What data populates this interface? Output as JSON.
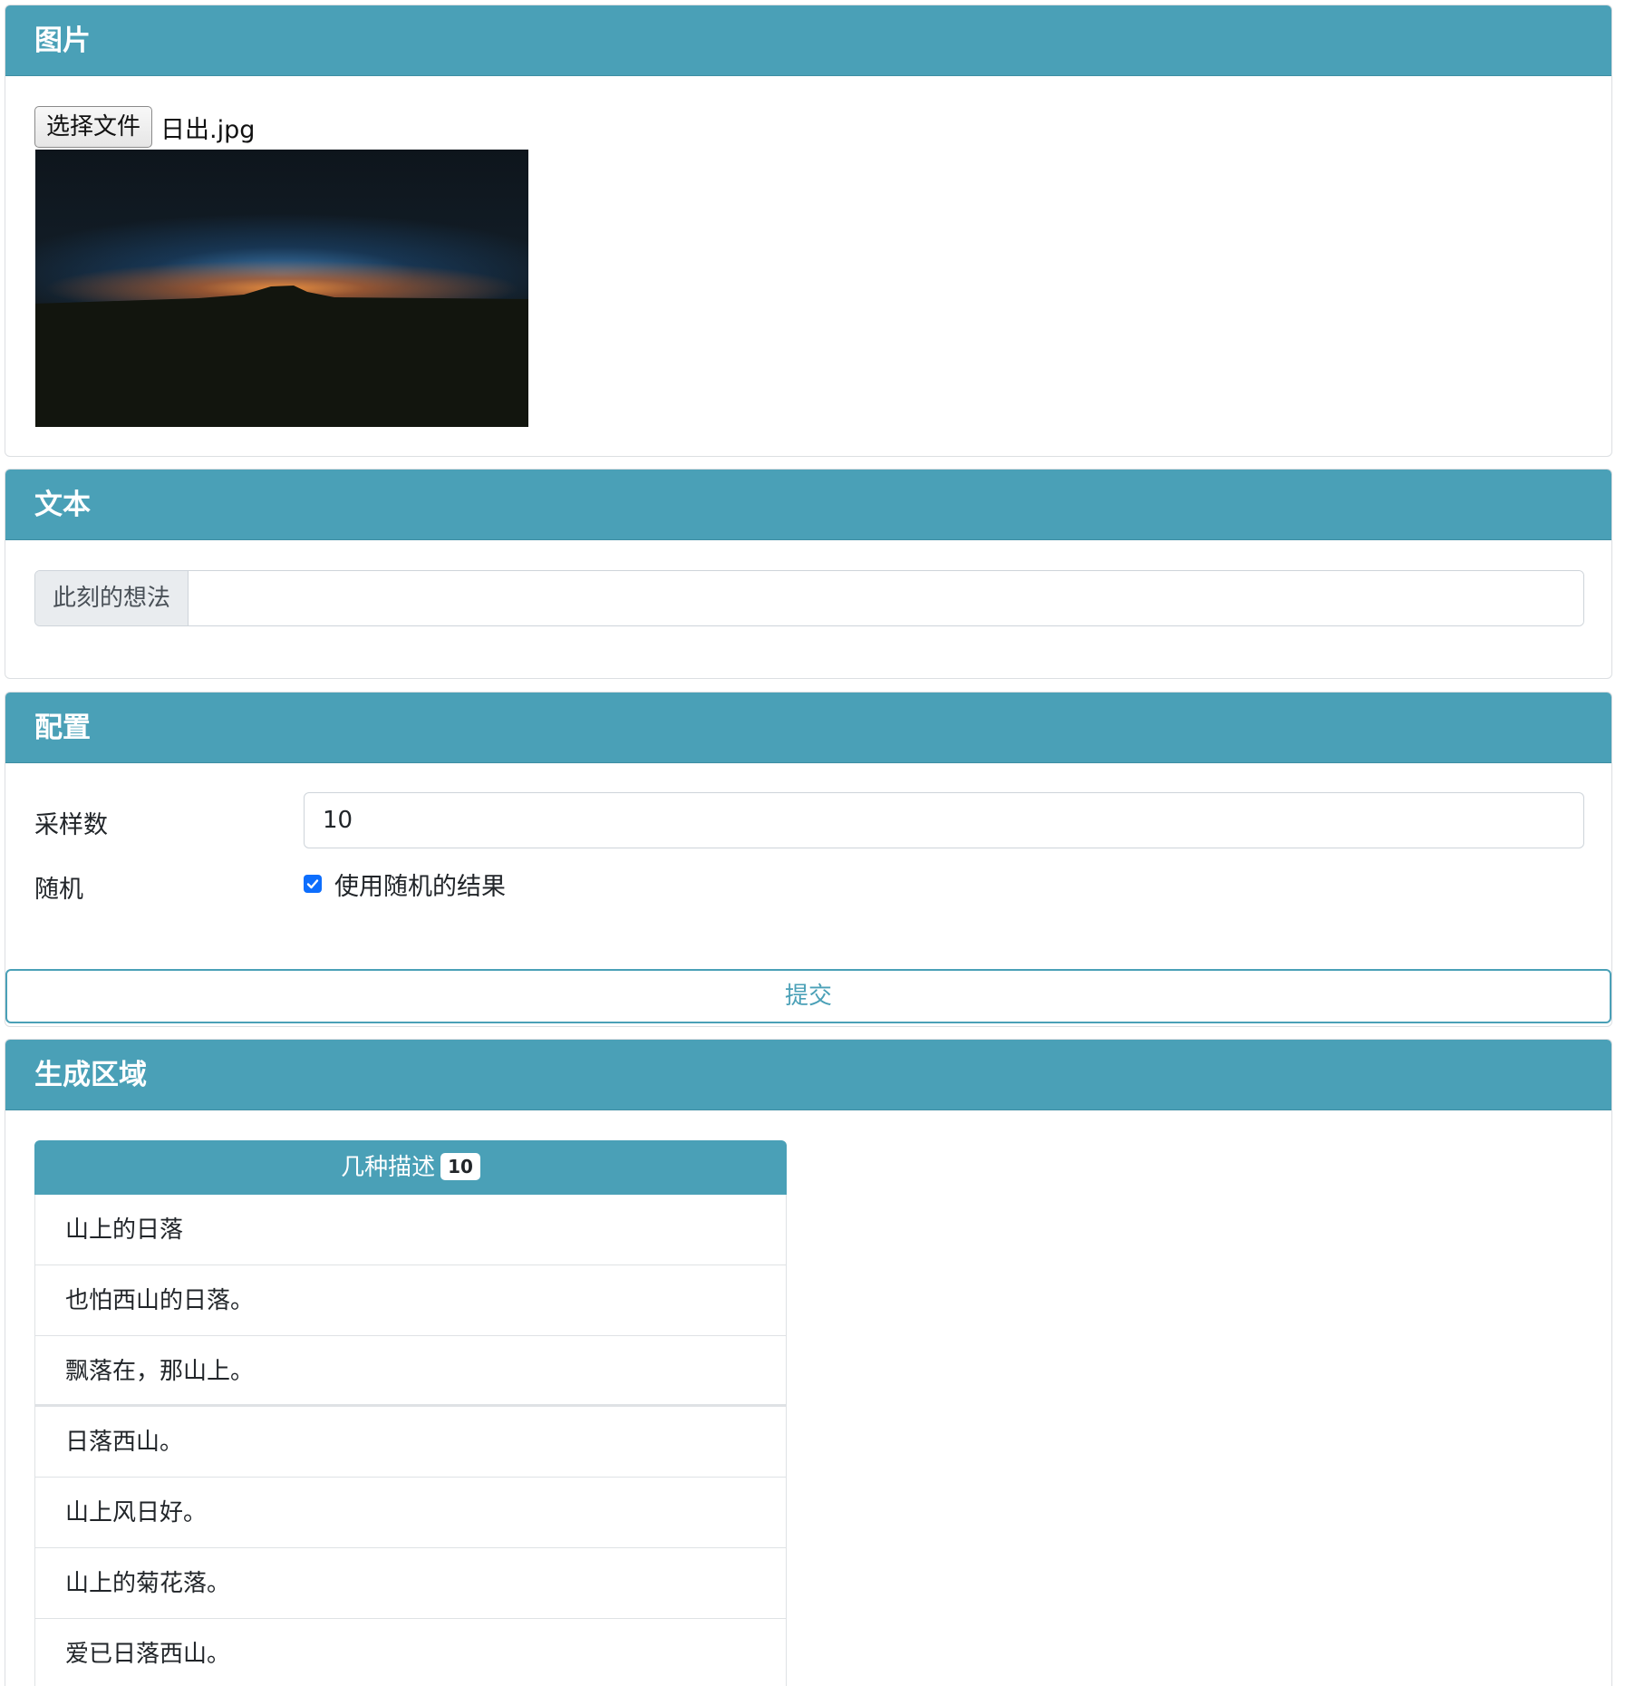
{
  "image_section": {
    "title": "图片",
    "file_button_label": "选择文件",
    "file_name": "日出.jpg"
  },
  "text_section": {
    "title": "文本",
    "input_addon": "此刻的想法",
    "input_value": ""
  },
  "config_section": {
    "title": "配置",
    "samples_label": "采样数",
    "samples_value": "10",
    "random_label": "随机",
    "random_checkbox_label": "使用随机的结果",
    "random_checked": true,
    "submit_label": "提交"
  },
  "results_section": {
    "title": "生成区域",
    "list_title": "几种描述",
    "count_badge": "10",
    "items": [
      "山上的日落",
      "也怕西山的日落。",
      "飘落在，那山上。",
      "日落西山。",
      "山上风日好。",
      "山上的菊花落。",
      "爱已日落西山。"
    ]
  },
  "colors": {
    "header_bg": "#4aa0b7",
    "checkbox": "#0d6efd"
  }
}
